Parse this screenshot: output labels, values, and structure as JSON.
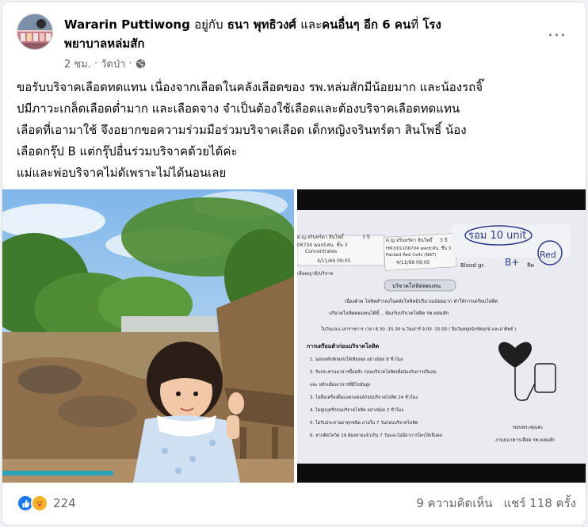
{
  "post": {
    "author": "Wararin Puttiwong",
    "with_word": "อยู่กับ",
    "tagged_person": "ธนา พุทธิวงศ์",
    "and_word": "และ",
    "others": "คนอื่นๆ อีก 6 คน",
    "at_word": "ที่",
    "location_line1": "โรง",
    "location_line2": "พยาบาลหล่มสัก",
    "time": "2 ชม.",
    "separator": "·",
    "place": "วัดป่า",
    "privacy_icon": "globe-icon",
    "more_label": "···"
  },
  "body": {
    "line1": "ขอรับบริจาคเลือดทดแทน เนื่องจากเลือดในคลังเลือดของ รพ.หล่มสักมีน้อยมาก และน้องรถจิ๊",
    "line2": "ปมีภาวะเกล็ดเลือดต่ำมาก และเลือดจาง จำเป็นต้องใช้เลือดและต้องบริจาคเลือดทดแทน",
    "line3": "เลือดที่เอามาใช้ จึงอยากขอความร่วมมือร่วมบริจาคเลือด เด็กหญิงจรินทร์ตา สินโพธิ์ น้อง",
    "line4": "เลือดกรุ๊ป B แต่กรุ๊ปอื่นร่วมบริจาคด้วยได้ค่ะ",
    "line5": "แม่และพ่อบริจาคไม่ดัเพราะไม่ได้นอนเลย"
  },
  "document": {
    "patient_label_1": "ด.ญ.จรินทร์ตา สินโพธิ์",
    "patient_label_2": "ด.ญ.จรินทร์ตา สินโพธิ์",
    "age": "3 ปี",
    "ward_line": "06704 ward:ศน. ชั้น 3",
    "ward_line_2": "HN:001106704 ward:ศน. ชั้น 3",
    "concentrates": "Concentrates",
    "packed": "Packed Red Cells (NAT)",
    "date1": "4/11/66 09:05",
    "date2": "4/11/66 09:05",
    "handwritten_note": "รอม 10 unit",
    "blood_group_label": "Blood gr.",
    "blood_group_value": "B+",
    "color_label": "สีค",
    "color_value": "Red",
    "label_side": "เลือดญาติ/บริจาค",
    "banner": "บริจาคโลหิตทดแทน",
    "intro1": "เนื่องด้วย โลหิตสำรองในคลังโลหิตมีปริมาณน้อยมาก ทำให้การเตรียมโลหิต",
    "intro2": "บริจาคโลหิตทดแทนได้ที่... ห้องรับบริจาคโลหิต   รพ.หล่มสัก",
    "hours": "ในวันและเวลาราชการ   เวลา 8.30 -15.30 น.วันเสาร์ 9.00 -15.00 ( ปิดวันหยุดนักขัตฤกษ์ และอาทิตย์ )",
    "prep_title": "การเตรียมตัวก่อนบริจาคโลหิต",
    "prep_items": [
      "1. นอนหลับพักผ่อนให้เพียงพอ อย่างน้อย 8 ชั่วโมง",
      "2. รับประทานอาหารมื้อหลัก ก่อนบริจาคโลหิตเพื่อป้องกันการเป็นลม",
      "    และ หลีกเลี่ยงอาหารที่มีไขมันสูง",
      "3. ไม่ดื่มเครื่องดื่มแอลกอฮอล์ก่อนบริจาคโลหิต 24 ชั่วโมง",
      "4. ไม่สูบบุหรี่ก่อนบริจาคโลหิต อย่างน้อย 2 ชั่วโมง",
      "5. ไม่รับประทานยาทุกชนิด ภายใน 7 วันก่อนบริจาคโลหิต",
      "6. หากติดโควิด 19 ต้องหายแล้วเกิน 7 วันและไม่มีอาการใดๆให้เจ็บคอ"
    ],
    "thanks": "ขอบพระคุณค่ะ",
    "dept": "งานธนาคารเลือด   รพ.หล่มสัก"
  },
  "footer": {
    "reaction_count": "224",
    "comments": "9 ความคิดเห็น",
    "shares": "แชร์ 118 ครั้ง",
    "like_icon": "like-icon",
    "care_icon": "care-icon"
  },
  "colors": {
    "accent": "#1877f2",
    "secondary_text": "#65676b",
    "primary_text": "#050505"
  }
}
